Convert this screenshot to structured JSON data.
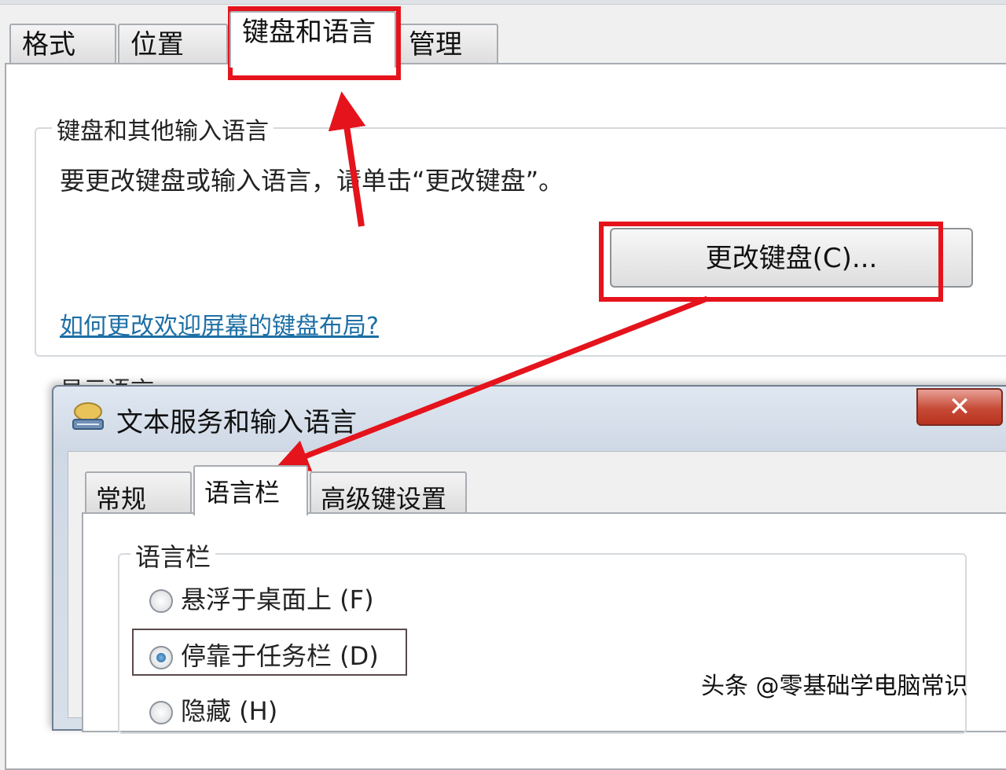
{
  "region_dialog": {
    "tabs": [
      "格式",
      "位置",
      "键盘和语言",
      "管理"
    ],
    "active_tab": "键盘和语言",
    "keyboard_group": {
      "legend": "键盘和其他输入语言",
      "description": "要更改键盘或输入语言，请单击“更改键盘”。",
      "change_button": "更改键盘(C)...",
      "help_link": "如何更改欢迎屏幕的键盘布局?"
    },
    "display_language_label": "显示语言"
  },
  "text_services_dialog": {
    "title": "文本服务和输入语言",
    "close_label": "✕",
    "tabs": [
      "常规",
      "语言栏",
      "高级键设置"
    ],
    "active_tab": "语言栏",
    "language_bar": {
      "legend": "语言栏",
      "options": [
        {
          "label": "悬浮于桌面上 (F)",
          "selected": false
        },
        {
          "label": "停靠于任务栏 (D)",
          "selected": true
        },
        {
          "label": "隐藏 (H)",
          "selected": false
        }
      ]
    }
  },
  "annotations": {
    "highlight_color": "#e5131c"
  },
  "watermark": "头条 @零基础学电脑常识"
}
